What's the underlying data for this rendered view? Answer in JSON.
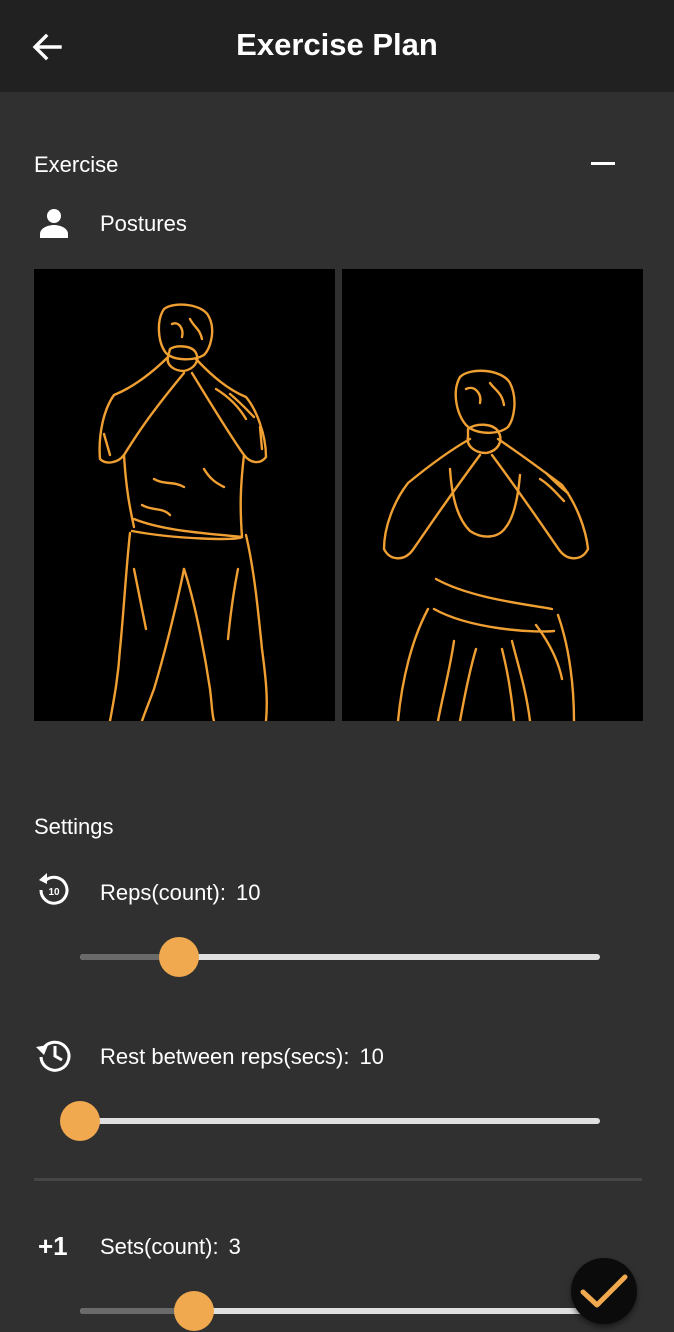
{
  "header": {
    "title": "Exercise Plan",
    "back_icon": "arrow-back-icon"
  },
  "exercise": {
    "section_title": "Exercise",
    "collapse_icon": "minus-icon",
    "postures_label": "Postures",
    "postures_icon": "person-icon",
    "images": [
      "posture-standing-outline",
      "posture-squat-outline"
    ]
  },
  "settings": {
    "section_title": "Settings",
    "reps": {
      "label": "Reps(count):",
      "value": "10",
      "icon": "replay-10-icon",
      "slider_fraction": 0.19
    },
    "rest": {
      "label": "Rest between reps(secs):",
      "value": "10",
      "icon": "history-icon",
      "slider_fraction": 0.0
    },
    "sets": {
      "label": "Sets(count):",
      "value": "3",
      "icon": "plus-one-icon",
      "icon_text": "+1",
      "slider_fraction": 0.22
    }
  },
  "fab": {
    "icon": "check-icon"
  },
  "colors": {
    "accent": "#f0a94e",
    "background": "#303030",
    "appbar": "#212121"
  }
}
